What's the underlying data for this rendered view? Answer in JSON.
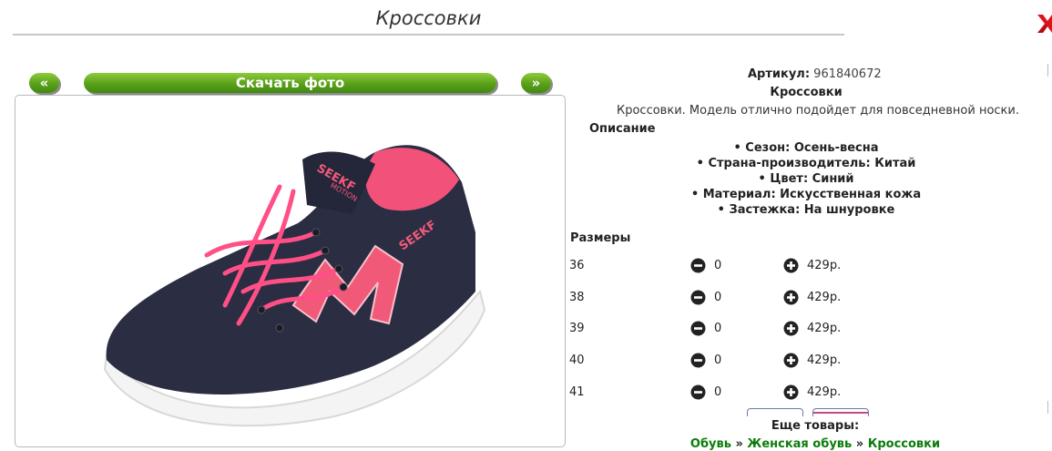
{
  "page": {
    "title": "Кроссовки"
  },
  "nav": {
    "prev_label": "«",
    "download_label": "Скачать фото",
    "next_label": "»"
  },
  "product": {
    "article_label": "Артикул:",
    "article_value": "961840672",
    "name": "Кроссовки",
    "short_description": "Кроссовки. Модель отлично подойдет для повседневной носки.",
    "description_heading": "Описание",
    "properties": [
      "Сезон: Осень-весна",
      "Страна-производитель: Китай",
      "Цвет: Синий",
      "Материал: Искусственная кожа",
      "Застежка: На шнуровке"
    ],
    "bullet": "•",
    "shoe_text": {
      "brand": "SEEKF",
      "tongue": "SEEKF",
      "tongue_small": "MOTION"
    }
  },
  "sizes": {
    "heading": "Размеры",
    "rows": [
      {
        "size": "36",
        "qty": "0",
        "price": "429р."
      },
      {
        "size": "38",
        "qty": "0",
        "price": "429р."
      },
      {
        "size": "39",
        "qty": "0",
        "price": "429р."
      },
      {
        "size": "40",
        "qty": "0",
        "price": "429р."
      },
      {
        "size": "41",
        "qty": "0",
        "price": "429р."
      }
    ]
  },
  "more": {
    "heading": "Еще товары:",
    "breadcrumb": [
      "Обувь",
      "Женская обувь",
      "Кроссовки"
    ],
    "separator": "»"
  },
  "colors": {
    "accent_green": "#5aa01a",
    "link_green": "#0a7d0a",
    "shoe_body": "#2b2d42",
    "shoe_pink": "#f2517a",
    "close_red": "#e0121b"
  },
  "icons": {
    "close": "close-x-icon",
    "minus": "minus-circle-icon",
    "plus": "plus-circle-icon"
  }
}
